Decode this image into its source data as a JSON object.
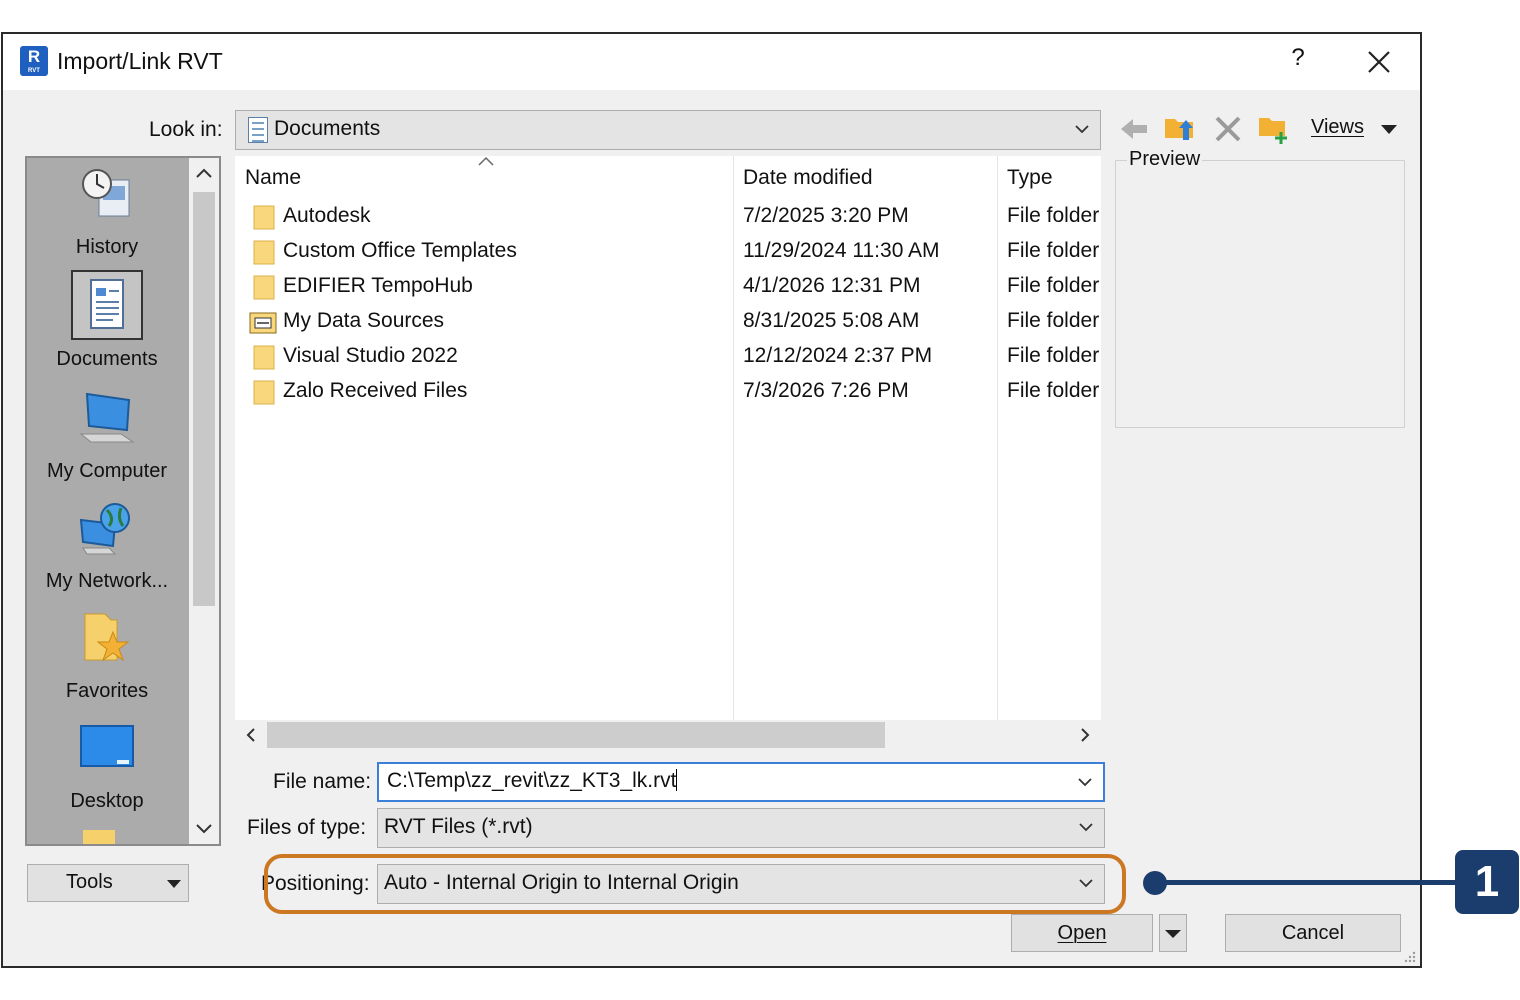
{
  "window": {
    "app_icon_letter": "R",
    "app_icon_sub": "RVT",
    "title": "Import/Link RVT",
    "help": "?"
  },
  "lookin": {
    "label": "Look in:",
    "value": "Documents"
  },
  "toolbar": {
    "views_label": "Views",
    "icons": [
      "back-arrow-icon",
      "folder-up-icon",
      "delete-icon",
      "new-folder-icon"
    ]
  },
  "places": [
    {
      "label": "History",
      "icon": "history-icon"
    },
    {
      "label": "Documents",
      "icon": "documents-icon",
      "selected": true
    },
    {
      "label": "My Computer",
      "icon": "computer-icon"
    },
    {
      "label": "My Network...",
      "icon": "network-icon"
    },
    {
      "label": "Favorites",
      "icon": "favorites-icon"
    },
    {
      "label": "Desktop",
      "icon": "desktop-icon"
    }
  ],
  "columns": {
    "name": "Name",
    "date": "Date modified",
    "type": "Type"
  },
  "files": [
    {
      "name": "Autodesk",
      "date": "7/2/2025 3:20 PM",
      "type": "File folder"
    },
    {
      "name": "Custom Office Templates",
      "date": "11/29/2024 11:30 AM",
      "type": "File folder"
    },
    {
      "name": "EDIFIER TempoHub",
      "date": "4/1/2026 12:31 PM",
      "type": "File folder"
    },
    {
      "name": "My Data Sources",
      "date": "8/31/2025 5:08 AM",
      "type": "File folder"
    },
    {
      "name": "Visual Studio 2022",
      "date": "12/12/2024 2:37 PM",
      "type": "File folder"
    },
    {
      "name": "Zalo Received Files",
      "date": "7/3/2026 7:26 PM",
      "type": "File folder"
    }
  ],
  "preview": {
    "label": "Preview"
  },
  "filename": {
    "label": "File name:",
    "value": "C:\\Temp\\zz_revit\\zz_KT3_lk.rvt"
  },
  "filetype": {
    "label": "Files of type:",
    "value": "RVT Files (*.rvt)"
  },
  "positioning": {
    "label": "Positioning:",
    "value": "Auto - Internal Origin to Internal Origin"
  },
  "buttons": {
    "tools": "Tools",
    "open": "Open",
    "cancel": "Cancel"
  },
  "callout": {
    "number": "1"
  },
  "colors": {
    "highlight": "#cc7722",
    "callout": "#1a3d6e",
    "focus": "#3b7fd8"
  }
}
